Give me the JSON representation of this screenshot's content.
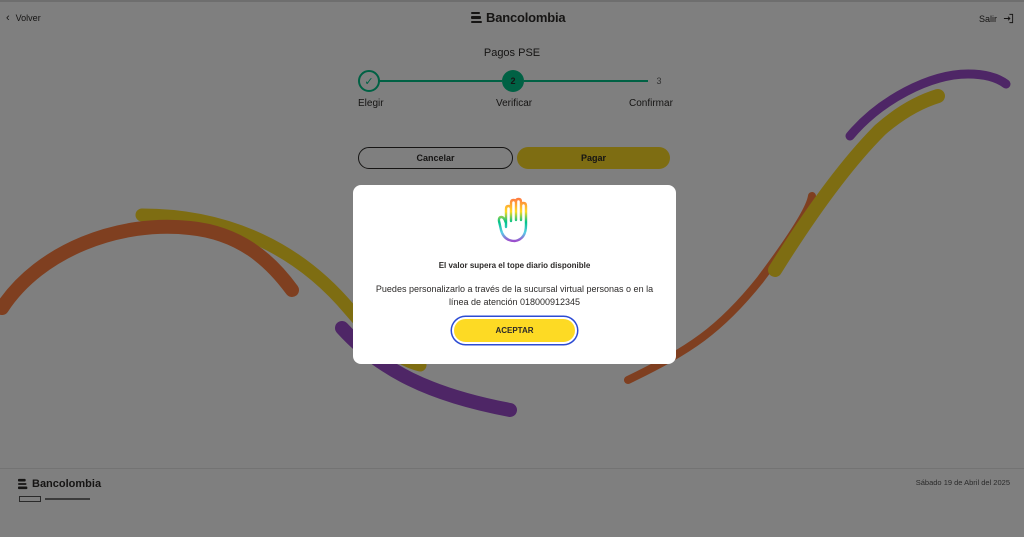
{
  "header": {
    "back_label": "Volver",
    "brand": "Bancolombia",
    "exit_label": "Salir"
  },
  "page": {
    "title": "Pagos PSE",
    "steps": [
      {
        "number": "1",
        "label": "Elegir",
        "state": "completed"
      },
      {
        "number": "2",
        "label": "Verificar",
        "state": "active"
      },
      {
        "number": "3",
        "label": "Confirmar",
        "state": "pending"
      }
    ],
    "cancel_label": "Cancelar",
    "pay_label": "Pagar"
  },
  "footer": {
    "brand": "Bancolombia",
    "date": "Sábado 19 de Abril del 2025"
  },
  "modal": {
    "icon": "raised-hand-icon",
    "title": "El valor supera el tope diario disponible",
    "body": "Puedes personalizarlo a través de la sucursal virtual personas o en la línea de atención 018000912345",
    "accept_label": "ACEPTAR"
  },
  "colors": {
    "brand_yellow": "#fdda24",
    "brand_green": "#00c389",
    "wave_orange": "#ff7f41",
    "wave_purple": "#9c4dcc",
    "focus_blue": "#2c4bd3"
  }
}
